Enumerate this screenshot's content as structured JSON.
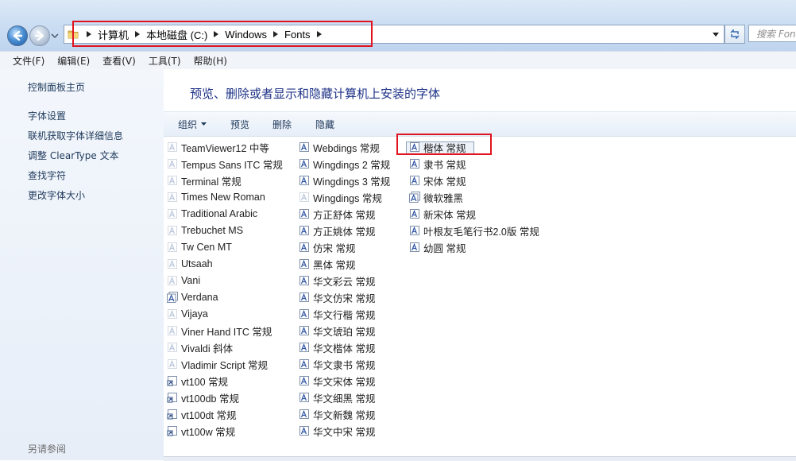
{
  "address": {
    "crumbs": [
      "计算机",
      "本地磁盘 (C:)",
      "Windows",
      "Fonts"
    ],
    "search_placeholder": "搜索 Fonts"
  },
  "menubar": {
    "items": [
      "文件(F)",
      "编辑(E)",
      "查看(V)",
      "工具(T)",
      "帮助(H)"
    ]
  },
  "sidebar": {
    "links": [
      "控制面板主页",
      "字体设置",
      "联机获取字体详细信息",
      "调整 ClearType 文本",
      "查找字符",
      "更改字体大小"
    ],
    "footer": "另请参阅"
  },
  "main": {
    "title": "预览、删除或者显示和隐藏计算机上安装的字体",
    "commands": [
      "组织",
      "预览",
      "删除",
      "隐藏"
    ],
    "columns": [
      [
        {
          "name": "TeamViewer12 中等",
          "icon": "font-icon-hidden"
        },
        {
          "name": "Tempus Sans ITC 常规",
          "icon": "font-icon-hidden"
        },
        {
          "name": "Terminal 常规",
          "icon": "font-icon-hidden"
        },
        {
          "name": "Times New Roman",
          "icon": "font-icon-hidden"
        },
        {
          "name": "Traditional Arabic",
          "icon": "font-icon-hidden"
        },
        {
          "name": "Trebuchet MS",
          "icon": "font-icon-hidden"
        },
        {
          "name": "Tw Cen MT",
          "icon": "font-icon-hidden"
        },
        {
          "name": "Utsaah",
          "icon": "font-icon-hidden"
        },
        {
          "name": "Vani",
          "icon": "font-icon-hidden"
        },
        {
          "name": "Verdana",
          "icon": "font-family-icon"
        },
        {
          "name": "Vijaya",
          "icon": "font-icon-hidden"
        },
        {
          "name": "Viner Hand ITC 常规",
          "icon": "font-icon-hidden"
        },
        {
          "name": "Vivaldi 斜体",
          "icon": "font-icon-hidden"
        },
        {
          "name": "Vladimir Script 常规",
          "icon": "font-icon-hidden"
        },
        {
          "name": "vt100 常规",
          "icon": "font-shortcut-icon"
        },
        {
          "name": "vt100db 常规",
          "icon": "font-shortcut-icon"
        },
        {
          "name": "vt100dt 常规",
          "icon": "font-shortcut-icon"
        },
        {
          "name": "vt100w 常规",
          "icon": "font-shortcut-icon"
        }
      ],
      [
        {
          "name": "Webdings 常规",
          "icon": "font-icon"
        },
        {
          "name": "Wingdings 2 常规",
          "icon": "font-icon"
        },
        {
          "name": "Wingdings 3 常规",
          "icon": "font-icon"
        },
        {
          "name": "Wingdings 常规",
          "icon": "font-icon-hidden"
        },
        {
          "name": "方正舒体 常规",
          "icon": "font-icon"
        },
        {
          "name": "方正姚体 常规",
          "icon": "font-icon"
        },
        {
          "name": "仿宋 常规",
          "icon": "font-icon"
        },
        {
          "name": "黑体 常规",
          "icon": "font-icon"
        },
        {
          "name": "华文彩云 常规",
          "icon": "font-icon"
        },
        {
          "name": "华文仿宋 常规",
          "icon": "font-icon"
        },
        {
          "name": "华文行楷 常规",
          "icon": "font-icon"
        },
        {
          "name": "华文琥珀 常规",
          "icon": "font-icon"
        },
        {
          "name": "华文楷体 常规",
          "icon": "font-icon"
        },
        {
          "name": "华文隶书 常规",
          "icon": "font-icon"
        },
        {
          "name": "华文宋体 常规",
          "icon": "font-icon"
        },
        {
          "name": "华文细黑 常规",
          "icon": "font-icon"
        },
        {
          "name": "华文新魏 常规",
          "icon": "font-icon"
        },
        {
          "name": "华文中宋 常规",
          "icon": "font-icon"
        }
      ],
      [
        {
          "name": "楷体 常规",
          "icon": "font-icon"
        },
        {
          "name": "隶书 常规",
          "icon": "font-icon"
        },
        {
          "name": "宋体 常规",
          "icon": "font-icon"
        },
        {
          "name": "微软雅黑",
          "icon": "font-family-icon"
        },
        {
          "name": "新宋体 常规",
          "icon": "font-icon"
        },
        {
          "name": "叶根友毛笔行书2.0版 常规",
          "icon": "font-icon"
        },
        {
          "name": "幼圆 常规",
          "icon": "font-icon"
        }
      ]
    ],
    "selected": "楷体 常规"
  },
  "colors": {
    "highlight_red": "#e0141e",
    "link_blue": "#1e395b",
    "title_blue": "#1e3287"
  }
}
